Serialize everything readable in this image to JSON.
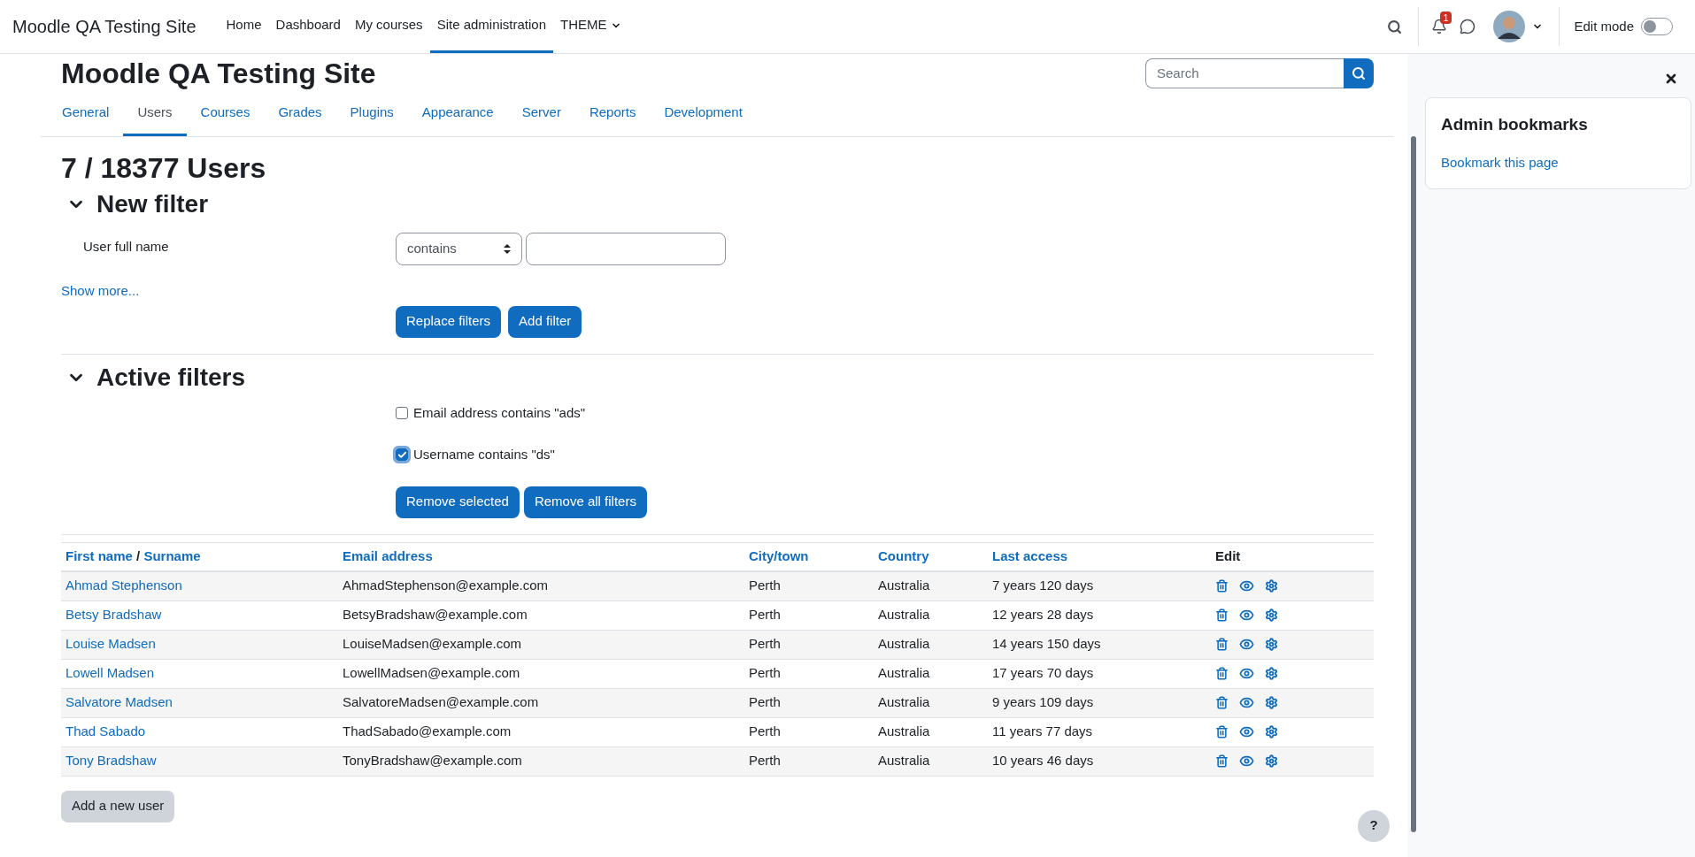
{
  "navbar": {
    "brand": "Moodle QA Testing Site",
    "items": [
      {
        "label": "Home",
        "selected": false,
        "has_menu": false
      },
      {
        "label": "Dashboard",
        "selected": false,
        "has_menu": false
      },
      {
        "label": "My courses",
        "selected": false,
        "has_menu": false
      },
      {
        "label": "Site administration",
        "selected": true,
        "has_menu": false
      },
      {
        "label": "THEME",
        "selected": false,
        "has_menu": true
      }
    ],
    "notification_count": "1",
    "edit_mode": {
      "label": "Edit mode",
      "on": false
    }
  },
  "page": {
    "title": "Moodle QA Testing Site",
    "search": {
      "placeholder": "Search"
    },
    "tabs": [
      {
        "label": "General",
        "selected": false
      },
      {
        "label": "Users",
        "selected": true
      },
      {
        "label": "Courses",
        "selected": false
      },
      {
        "label": "Grades",
        "selected": false
      },
      {
        "label": "Plugins",
        "selected": false
      },
      {
        "label": "Appearance",
        "selected": false
      },
      {
        "label": "Server",
        "selected": false
      },
      {
        "label": "Reports",
        "selected": false
      },
      {
        "label": "Development",
        "selected": false
      }
    ],
    "heading": "7 / 18377 Users",
    "new_filter": {
      "title": "New filter",
      "expanded": true,
      "field_label": "User full name",
      "operator": "contains",
      "show_more": "Show more...",
      "buttons": [
        "Replace filters",
        "Add filter"
      ]
    },
    "active_filters": {
      "title": "Active filters",
      "expanded": true,
      "filters": [
        {
          "label": "Email address contains \"ads\"",
          "checked": false
        },
        {
          "label": "Username contains \"ds\"",
          "checked": true
        }
      ],
      "buttons": [
        "Remove selected",
        "Remove all filters"
      ]
    },
    "table": {
      "columns": [
        {
          "labels": [
            "First name",
            "Surname"
          ],
          "separator": "/",
          "sortable": true
        },
        {
          "labels": [
            "Email address"
          ],
          "sortable": true
        },
        {
          "labels": [
            "City/town"
          ],
          "sortable": true
        },
        {
          "labels": [
            "Country"
          ],
          "sortable": true
        },
        {
          "labels": [
            "Last access"
          ],
          "sortable": true
        },
        {
          "labels": [
            "Edit"
          ],
          "sortable": false
        }
      ],
      "rows": [
        {
          "name": "Ahmad Stephenson",
          "email": "AhmadStephenson@example.com",
          "city": "Perth",
          "country": "Australia",
          "last_access": "7 years 120 days"
        },
        {
          "name": "Betsy Bradshaw",
          "email": "BetsyBradshaw@example.com",
          "city": "Perth",
          "country": "Australia",
          "last_access": "12 years 28 days"
        },
        {
          "name": "Louise Madsen",
          "email": "LouiseMadsen@example.com",
          "city": "Perth",
          "country": "Australia",
          "last_access": "14 years 150 days"
        },
        {
          "name": "Lowell Madsen",
          "email": "LowellMadsen@example.com",
          "city": "Perth",
          "country": "Australia",
          "last_access": "17 years 70 days"
        },
        {
          "name": "Salvatore Madsen",
          "email": "SalvatoreMadsen@example.com",
          "city": "Perth",
          "country": "Australia",
          "last_access": "9 years 109 days"
        },
        {
          "name": "Thad Sabado",
          "email": "ThadSabado@example.com",
          "city": "Perth",
          "country": "Australia",
          "last_access": "11 years 77 days"
        },
        {
          "name": "Tony Bradshaw",
          "email": "TonyBradshaw@example.com",
          "city": "Perth",
          "country": "Australia",
          "last_access": "10 years 46 days"
        }
      ]
    },
    "add_button": "Add a new user",
    "help_button": "?"
  },
  "drawer": {
    "title": "Admin bookmarks",
    "link": "Bookmark this page"
  }
}
